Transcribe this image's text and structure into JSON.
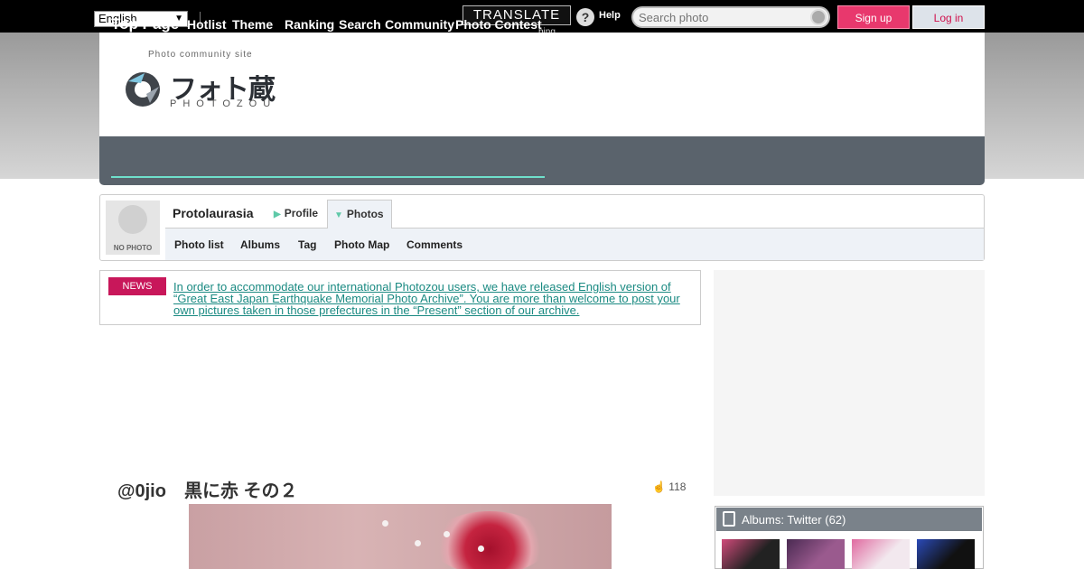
{
  "topbar": {
    "language": "English",
    "translate_label": "TRANSLATE",
    "bing_label": "bing",
    "help_label": "Help",
    "search_placeholder": "Search photo",
    "signup_label": "Sign up",
    "login_label": "Log in"
  },
  "logo": {
    "tagline": "Photo community site",
    "jp_text": "フォト蔵",
    "en_text": "PHOTOZOU"
  },
  "nav": {
    "items": [
      "Top Page",
      "Hotlist",
      "Theme",
      "Ranking",
      "Search",
      "Community",
      "Photo Contest"
    ]
  },
  "profile": {
    "avatar_label": "NO PHOTO",
    "user_name": "Protolaurasia",
    "tabs": [
      "Profile",
      "Photos"
    ],
    "subnav": [
      "Photo list",
      "Albums",
      "Tag",
      "Photo Map",
      "Comments"
    ]
  },
  "news": {
    "badge": "NEWS",
    "text": "In order to accommodate our international Photozou users, we have released English version of “Great East Japan Earthquake Memorial Photo Archive”. You are more than welcome to post your own pictures taken in those prefectures in the “Present” section of our archive."
  },
  "photo": {
    "title": "@0jio　黒に赤 その２",
    "views": "118"
  },
  "albums": {
    "header": "Albums: Twitter",
    "count": "(62)"
  },
  "colors": {
    "accent_pink": "#e8386d",
    "nav_bg": "#5a636c",
    "nav_underline": "#6fe0cc",
    "news_badge": "#c8175a",
    "link_teal": "#1a8a82"
  }
}
